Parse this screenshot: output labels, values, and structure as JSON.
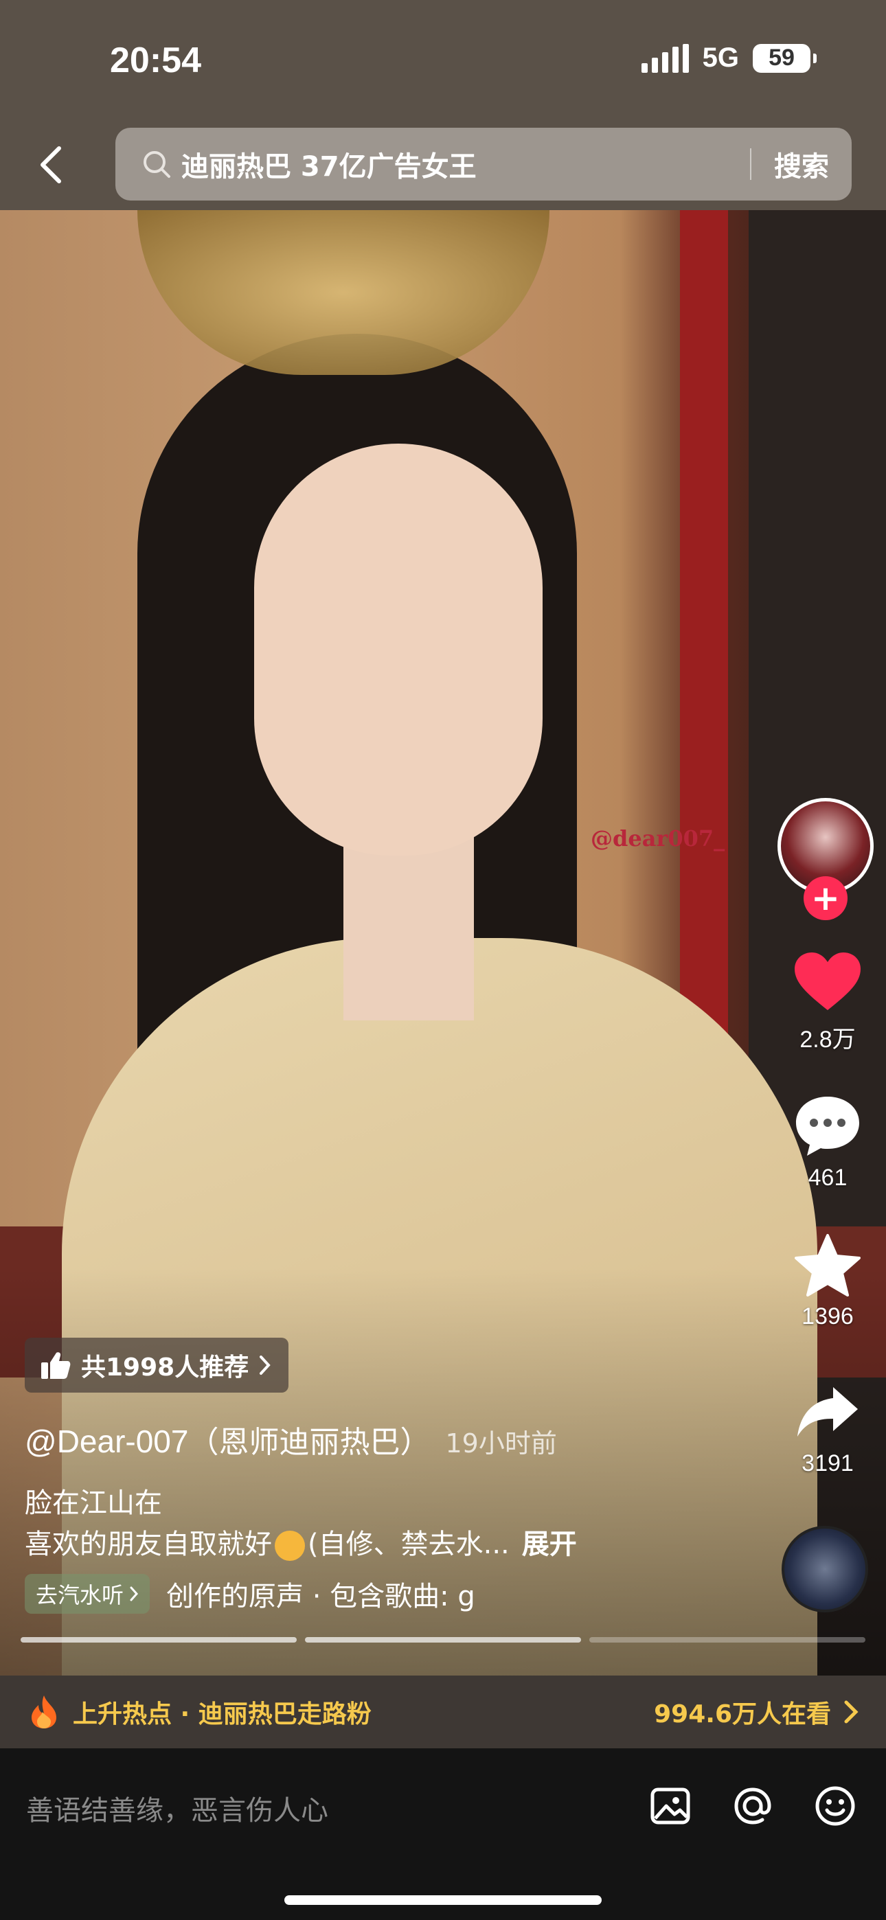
{
  "status_bar": {
    "time": "20:54",
    "network": "5G",
    "battery": "59"
  },
  "search": {
    "query": "迪丽热巴 37亿广告女王",
    "button_label": "搜索"
  },
  "video": {
    "watermark": "@dear007_"
  },
  "actions": {
    "likes": "2.8万",
    "comments": "461",
    "favorites": "1396",
    "shares": "3191"
  },
  "caption": {
    "recommend": "共1998人推荐",
    "author": "@Dear-007",
    "author_cn": "（恩师迪丽热巴）",
    "time_ago": "19小时前",
    "line1": "脸在江山在",
    "line2_a": "喜欢的朋友自取就好",
    "line2_b": "(自修、禁去水...",
    "expand": "展开",
    "music_tag": "去汽水听",
    "music_text": "创作的原声 · 包含歌曲: g"
  },
  "hot_topic": {
    "label": "上升热点 · 迪丽热巴走路粉",
    "watching": "994.6万人在看"
  },
  "comment_bar": {
    "placeholder": "善语结善缘，恶言伤人心"
  },
  "colors": {
    "accent_red": "#fe2c55",
    "hot_yellow": "#f6c94d",
    "topbar": "#5a5148"
  }
}
